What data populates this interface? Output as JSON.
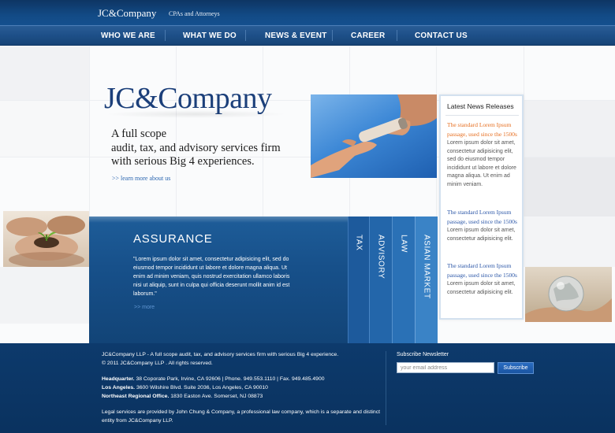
{
  "header": {
    "logo": "JC&Company",
    "tagline": "CPAs and Attorneys"
  },
  "nav": {
    "items": [
      "WHO WE ARE",
      "WHAT WE DO",
      "NEWS & EVENT",
      "CAREER",
      "CONTACT US"
    ]
  },
  "hero": {
    "brand": "JC&Company",
    "headline_1": "A full scope",
    "headline_2": "audit, tax, and advisory services firm",
    "headline_3": "with serious Big 4 experiences.",
    "link": ">> learn more about us"
  },
  "news": {
    "title": "Latest News Releases",
    "items": [
      {
        "headline": "The standard Lorem Ipsum passage, used since the 1500s",
        "body": "Lorem ipsum dolor sit amet, consectetur adipisicing elit, sed do eiusmod tempor incididunt ut labore et dolore magna aliqua. Ut enim ad minim veniam."
      },
      {
        "headline": "The standard Lorem Ipsum passage, used since the 1500s",
        "body": "Lorem ipsum dolor sit amet, consectetur adipisicing elit."
      },
      {
        "headline": "The standard Lorem Ipsum passage, used since the 1500s",
        "body": "Lorem ipsum dolor sit amet, consectetur adipisicing elit."
      }
    ]
  },
  "services": {
    "active_title": "ASSURANCE",
    "active_text": "\"Lorem ipsum dolor sit amet, consectetur adipisicing elit, sed do eiusmod tempor incididunt ut labore et dolore magna aliqua. Ut enim ad minim veniam, quis nostrud exercitation ullamco laboris nisi ut aliquip, sunt in culpa qui officia deserunt mollit anim id est laborum.\"",
    "more": ">> more",
    "tabs": [
      "TAX",
      "ADVISORY",
      "LAW",
      "ASIAN MARKET"
    ]
  },
  "footer": {
    "line1": "JC&Company LLP - A full scope audit, tax, and advisory services firm with serious Big 4 experience.",
    "line2": "© 2011 JC&Company LLP . All rights reserved.",
    "offices": [
      {
        "label": "Headquarter.",
        "text": " 38 Coporate Park, Irvine, CA 92606  |  Phone. 949.553.1110  |  Fax. 949.485.4900"
      },
      {
        "label": "Los Angeles.",
        "text": " 3600 Wilshire Blvd. Suite 2036, Los Angeles, CA 90010"
      },
      {
        "label": "Northeast Regional Office.",
        "text": " 1830 Easton Ave. Somerset, NJ 08873"
      }
    ],
    "legal_1": "Legal services are provided by John Chung & Company, a professional law company, which is a separate and distinct",
    "legal_2": "entity from JC&Company LLP.",
    "subscribe": {
      "label": "Subscribe Newsletter",
      "placeholder": "your email address",
      "button": "Subscribe"
    }
  },
  "colors": {
    "brand_navy": "#1b3f7a",
    "band_blue": "#17508a",
    "news_highlight": "#e66f21",
    "news_link": "#2c57a8"
  }
}
